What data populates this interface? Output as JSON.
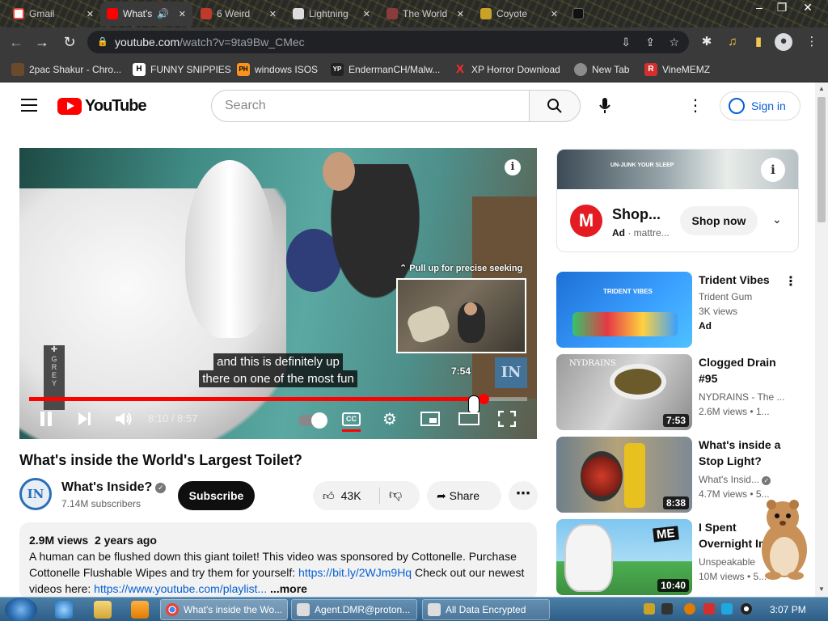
{
  "browser": {
    "tabs": [
      {
        "label": "Gmail",
        "active": false
      },
      {
        "label": "What's inside the World's Largest Toilet?",
        "active": true
      },
      {
        "label": "6 Weird",
        "active": false
      },
      {
        "label": "Lightning",
        "active": false
      },
      {
        "label": "The World",
        "active": false
      },
      {
        "label": "Coyote",
        "active": false
      }
    ],
    "url_domain": "youtube.com",
    "url_path": "/watch?v=9ta9Bw_CMec",
    "bookmarks": [
      {
        "label": "2pac Shakur - Chro...",
        "icon": "2"
      },
      {
        "label": "FUNNY SNIPPIES",
        "icon": "H"
      },
      {
        "label": "windows ISOS",
        "icon": "PH"
      },
      {
        "label": "EndermanCH/Malw...",
        "icon": "YP"
      },
      {
        "label": "XP Horror Download",
        "icon": "X"
      },
      {
        "label": "New Tab",
        "icon": "globe"
      },
      {
        "label": "VineMEMZ",
        "icon": "R"
      }
    ]
  },
  "youtube": {
    "logo_text": "YouTube",
    "search_placeholder": "Search",
    "sign_in": "Sign in"
  },
  "player": {
    "pull_up_hint": "Pull up for precise seeking",
    "preview_time": "7:54",
    "caption_line1": "and this is definitely up",
    "caption_line2": "there on one of the most fun",
    "current_time": "8:10",
    "duration": "8:57",
    "time_display": "8:10 / 8:57",
    "progress_fraction": 0.913,
    "cc_label": "CC",
    "watermark": "IN",
    "grey_sign": "GREY"
  },
  "video": {
    "title": "What's inside the World's Largest Toilet?",
    "channel": "What's Inside?",
    "channel_avatar_text": "IN",
    "subscribers": "7.14M subscribers",
    "subscribe_label": "Subscribe",
    "likes": "43K",
    "share_label": "Share",
    "views": "2.9M views",
    "age": "2 years ago",
    "description_text": "A human can be flushed down this giant toilet! This video was sponsored by Cottonelle. Purchase Cottonelle Flushable Wipes and try them for yourself: ",
    "link1": "https://bit.ly/2WJm9Hq",
    "description_mid": " Check out our newest videos here: ",
    "link2": "https://www.youtube.com/playlist...",
    "more_label": "...more"
  },
  "ad": {
    "banner_text": "UN-JUNK YOUR SLEEP",
    "brand_letter": "M",
    "name": "Shop...",
    "ad_label": "Ad",
    "advertiser": "mattre...",
    "cta": "Shop now"
  },
  "recommendations": [
    {
      "title": "Trident Vibes",
      "channel": "Trident Gum",
      "meta": "3K views",
      "badge": "Ad",
      "duration": "",
      "thumb_text": "TRIDENT VIBES"
    },
    {
      "title": "Clogged Drain #95",
      "channel": "NYDRAINS - The ...",
      "meta": "2.6M views • 1...",
      "badge": "",
      "duration": "7:53",
      "thumb_text": "NYDRAINS"
    },
    {
      "title": "What's inside a Stop Light?",
      "channel": "What's Insid...",
      "meta": "4.7M views • 5...",
      "badge": "",
      "duration": "8:38",
      "thumb_text": ""
    },
    {
      "title": "I Spent Overnight In...",
      "channel": "Unspeakable",
      "meta": "10M views • 5...",
      "badge": "",
      "duration": "10:40",
      "thumb_text": "ME"
    }
  ],
  "taskbar": {
    "tasks": [
      {
        "label": "What's inside the Wo..."
      },
      {
        "label": "Agent.DMR@proton..."
      },
      {
        "label": "All Data Encrypted"
      }
    ],
    "clock": "3:07 PM"
  },
  "colors": {
    "yt_red": "#ff0000",
    "link_blue": "#065fd4",
    "browser_dark": "#3a3a3a",
    "taskbar_blue": "#2d5e88"
  }
}
